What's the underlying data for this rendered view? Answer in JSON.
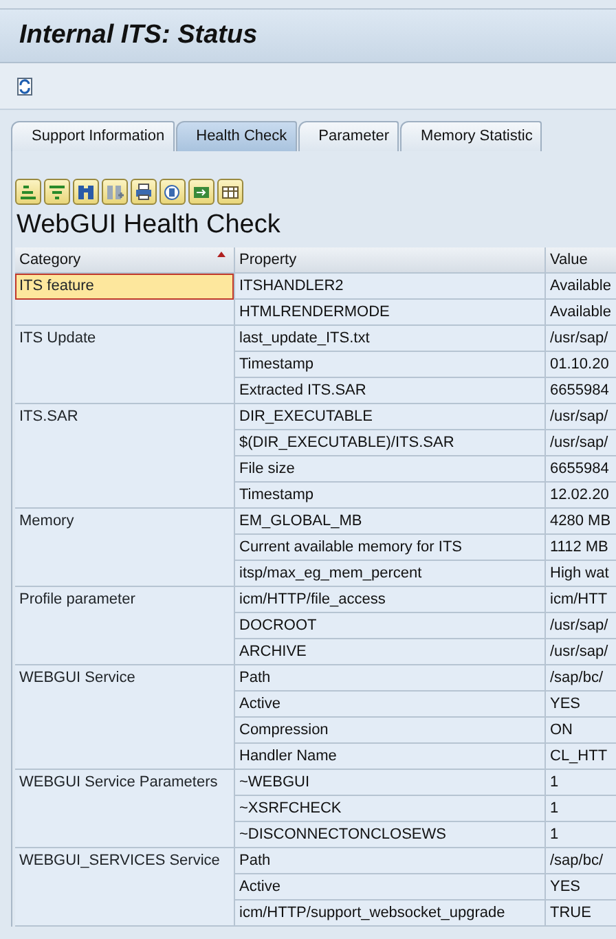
{
  "window": {
    "title": "Internal ITS: Status"
  },
  "tabs": [
    {
      "label": "Support Information",
      "selected": false
    },
    {
      "label": "Health Check",
      "selected": true
    },
    {
      "label": "Parameter",
      "selected": false
    },
    {
      "label": "Memory Statistic",
      "selected": false
    }
  ],
  "heading": "WebGUI Health Check",
  "table": {
    "columns": [
      "Category",
      "Property",
      "Value"
    ],
    "groups": [
      {
        "category": "ITS feature",
        "selected": true,
        "rows": [
          [
            "ITSHANDLER2",
            "Available"
          ],
          [
            "HTMLRENDERMODE",
            "Available"
          ]
        ]
      },
      {
        "category": "ITS Update",
        "selected": false,
        "rows": [
          [
            "last_update_ITS.txt",
            "/usr/sap/"
          ],
          [
            "Timestamp",
            "01.10.20"
          ],
          [
            "Extracted ITS.SAR",
            "6655984"
          ]
        ]
      },
      {
        "category": "ITS.SAR",
        "selected": false,
        "rows": [
          [
            "DIR_EXECUTABLE",
            "/usr/sap/"
          ],
          [
            "$(DIR_EXECUTABLE)/ITS.SAR",
            "/usr/sap/"
          ],
          [
            "File size",
            "6655984"
          ],
          [
            "Timestamp",
            "12.02.20"
          ]
        ]
      },
      {
        "category": "Memory",
        "selected": false,
        "rows": [
          [
            "EM_GLOBAL_MB",
            "4280 MB"
          ],
          [
            "Current available memory for ITS",
            "1112 MB"
          ],
          [
            "itsp/max_eg_mem_percent",
            "High wat"
          ]
        ]
      },
      {
        "category": "Profile parameter",
        "selected": false,
        "rows": [
          [
            "icm/HTTP/file_access",
            "icm/HTT"
          ],
          [
            "DOCROOT",
            "/usr/sap/"
          ],
          [
            "ARCHIVE",
            "/usr/sap/"
          ]
        ]
      },
      {
        "category": "WEBGUI Service",
        "selected": false,
        "rows": [
          [
            "Path",
            "/sap/bc/"
          ],
          [
            "Active",
            "YES"
          ],
          [
            "Compression",
            "ON"
          ],
          [
            "Handler Name",
            "CL_HTT"
          ]
        ]
      },
      {
        "category": "WEBGUI Service Parameters",
        "selected": false,
        "rows": [
          [
            "~WEBGUI",
            "1"
          ],
          [
            "~XSRFCHECK",
            "1"
          ],
          [
            "~DISCONNECTONCLOSEWS",
            "1"
          ]
        ]
      },
      {
        "category": "WEBGUI_SERVICES Service",
        "selected": false,
        "rows": [
          [
            "Path",
            "/sap/bc/"
          ],
          [
            "Active",
            "YES"
          ],
          [
            "icm/HTTP/support_websocket_upgrade",
            "TRUE"
          ]
        ]
      }
    ]
  }
}
